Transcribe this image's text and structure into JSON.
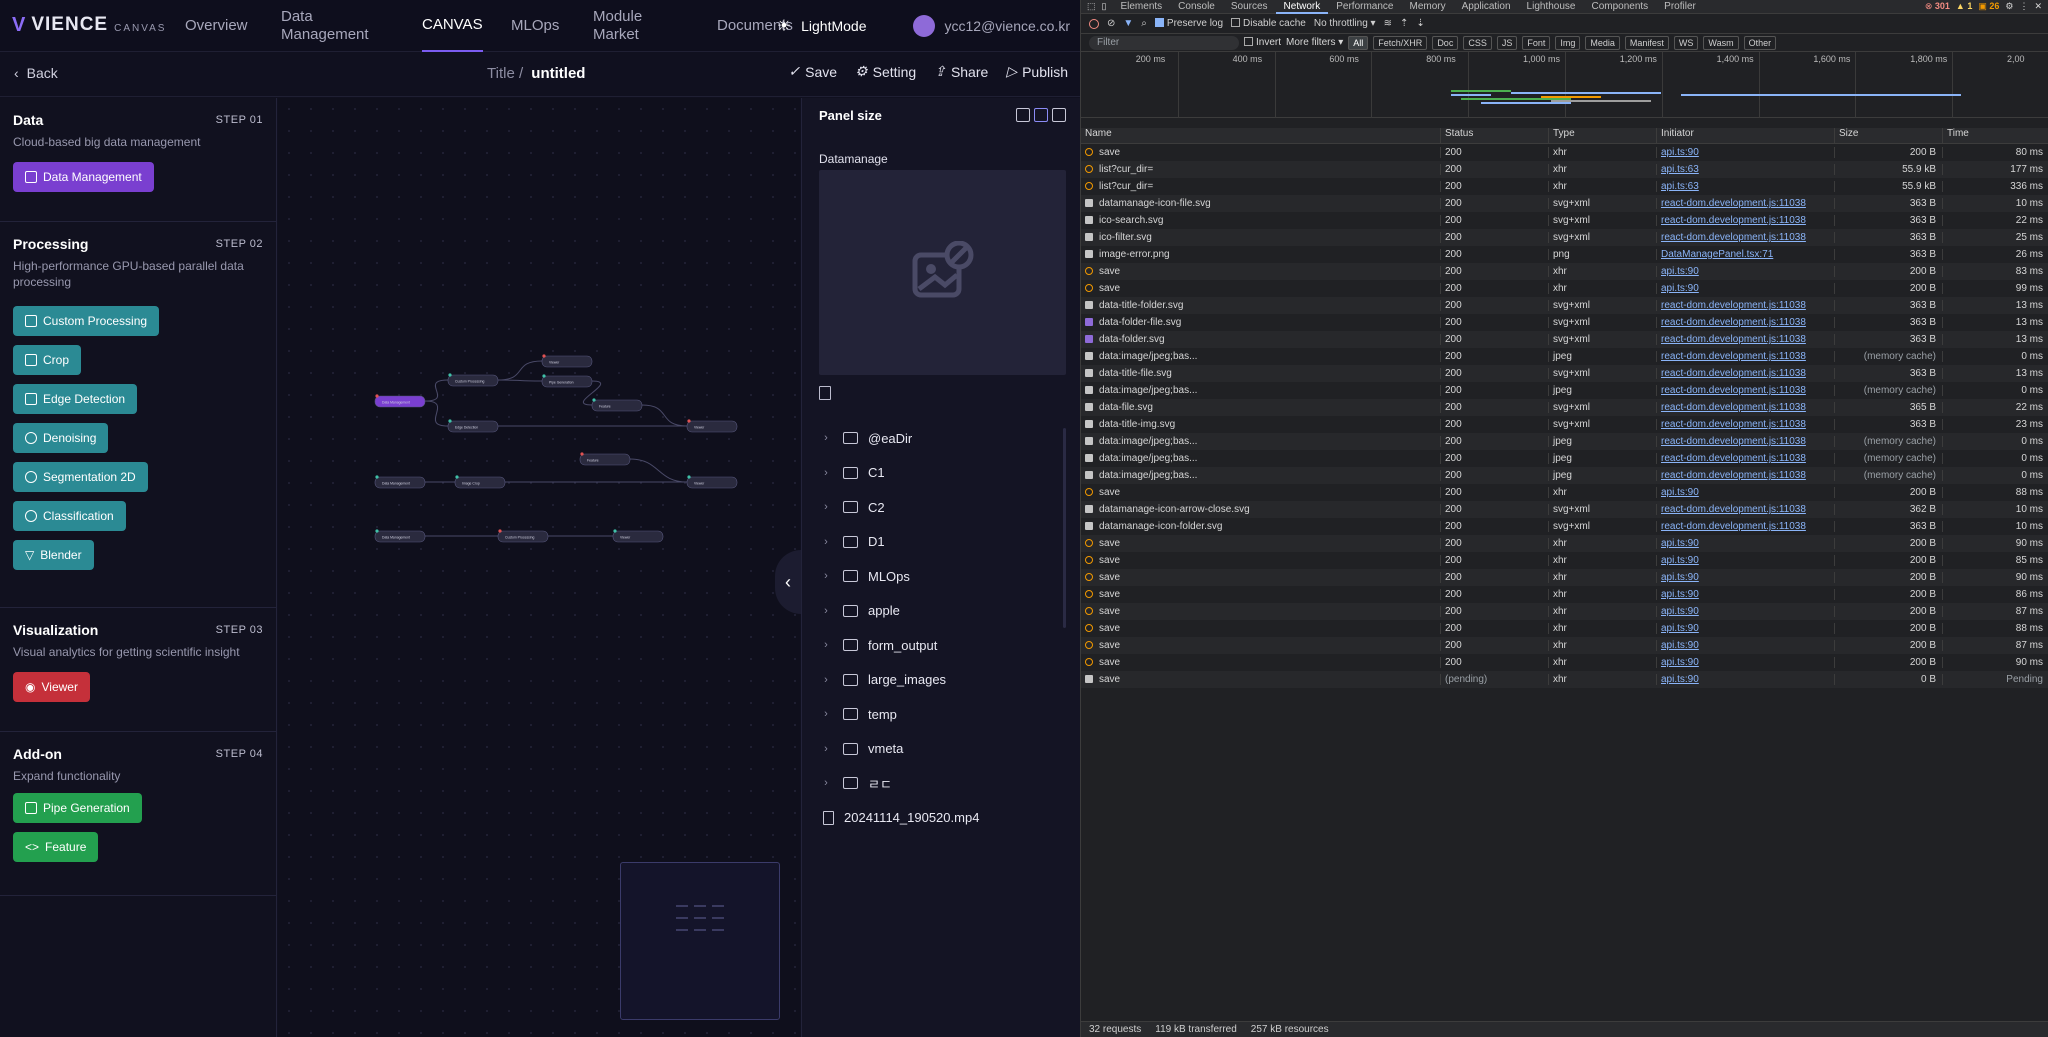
{
  "nav": {
    "logo_mark": "V",
    "logo_word": "VIENCE",
    "logo_sub": "CANVAS",
    "items": [
      "Overview",
      "Data Management",
      "CANVAS",
      "MLOps",
      "Module Market",
      "Documents"
    ],
    "active": "CANVAS",
    "theme_label": "LightMode",
    "user_email": "ycc12@vience.co.kr"
  },
  "toolbar": {
    "back_label": "Back",
    "title_prefix": "Title /",
    "title": "untitled",
    "save": "Save",
    "setting": "Setting",
    "share": "Share",
    "publish": "Publish"
  },
  "sidebar": {
    "sections": [
      {
        "title": "Data",
        "step": "STEP 01",
        "desc": "Cloud-based big data management",
        "buttons": [
          "Data Management"
        ]
      },
      {
        "title": "Processing",
        "step": "STEP 02",
        "desc": "High-performance GPU-based parallel data processing",
        "buttons": [
          "Custom Processing",
          "Crop",
          "Edge Detection",
          "Denoising",
          "Segmentation 2D",
          "Classification",
          "Blender"
        ]
      },
      {
        "title": "Visualization",
        "step": "STEP 03",
        "desc": "Visual analytics for getting scientific insight",
        "buttons": [
          "Viewer"
        ]
      },
      {
        "title": "Add-on",
        "step": "STEP 04",
        "desc": "Expand functionality",
        "buttons": [
          "Pipe Generation",
          "Feature"
        ]
      }
    ]
  },
  "canvas": {
    "nodes": [
      {
        "label": "Data Management",
        "color": "#7a3fd0"
      },
      {
        "label": "Custom Processing",
        "color": "#2a2a3e"
      },
      {
        "label": "Edge Detection",
        "color": "#2a2a3e"
      },
      {
        "label": "Viewer",
        "color": "#2a2a3e"
      },
      {
        "label": "Pipe Generation",
        "color": "#2a2a3e"
      },
      {
        "label": "Feature",
        "color": "#2a2a3e"
      },
      {
        "label": "Viewer",
        "color": "#2a2a3e"
      },
      {
        "label": "Data Management",
        "color": "#2a2a3e"
      },
      {
        "label": "Image Crop",
        "color": "#2a2a3e"
      },
      {
        "label": "Feature",
        "color": "#2a2a3e"
      },
      {
        "label": "Viewer",
        "color": "#2a2a3e"
      },
      {
        "label": "Data Management",
        "color": "#2a2a3e"
      },
      {
        "label": "Custom Processing",
        "color": "#2a2a3e"
      },
      {
        "label": "Viewer",
        "color": "#2a2a3e"
      }
    ]
  },
  "panel": {
    "title": "Panel size",
    "section_label": "Datamanage",
    "folders": [
      "@eaDir",
      "C1",
      "C2",
      "D1",
      "MLOps",
      "apple",
      "form_output",
      "large_images",
      "temp",
      "vmeta",
      "ㄹㄷ"
    ],
    "file": "20241114_190520.mp4"
  },
  "devtools": {
    "tabs": [
      "Elements",
      "Console",
      "Sources",
      "Network",
      "Performance",
      "Memory",
      "Application",
      "Lighthouse",
      "Components",
      "Profiler"
    ],
    "active_tab": "Network",
    "status": {
      "errors": "301",
      "warnings": "1",
      "info": "26"
    },
    "bar1": {
      "preserve_log": "Preserve log",
      "disable_cache": "Disable cache",
      "throttle": "No throttling"
    },
    "bar2": {
      "filter_placeholder": "Filter",
      "invert": "Invert",
      "more_filters": "More filters",
      "chips": [
        "All",
        "Fetch/XHR",
        "Doc",
        "CSS",
        "JS",
        "Font",
        "Img",
        "Media",
        "Manifest",
        "WS",
        "Wasm",
        "Other"
      ]
    },
    "timeline_ticks": [
      "200 ms",
      "400 ms",
      "600 ms",
      "800 ms",
      "1,000 ms",
      "1,200 ms",
      "1,400 ms",
      "1,600 ms",
      "1,800 ms",
      "2,00"
    ],
    "columns": [
      "Name",
      "Status",
      "Type",
      "Initiator",
      "Size",
      "Time"
    ],
    "rows": [
      [
        "save",
        "200",
        "xhr",
        "api.ts:90",
        "200 B",
        "80 ms",
        "xhr"
      ],
      [
        "list?cur_dir=",
        "200",
        "xhr",
        "api.ts:63",
        "55.9 kB",
        "177 ms",
        "xhr"
      ],
      [
        "list?cur_dir=",
        "200",
        "xhr",
        "api.ts:63",
        "55.9 kB",
        "336 ms",
        "xhr"
      ],
      [
        "datamanage-icon-file.svg",
        "200",
        "svg+xml",
        "react-dom.development.js:11038",
        "363 B",
        "10 ms",
        "svg"
      ],
      [
        "ico-search.svg",
        "200",
        "svg+xml",
        "react-dom.development.js:11038",
        "363 B",
        "22 ms",
        "svg"
      ],
      [
        "ico-filter.svg",
        "200",
        "svg+xml",
        "react-dom.development.js:11038",
        "363 B",
        "25 ms",
        "svg"
      ],
      [
        "image-error.png",
        "200",
        "png",
        "DataManagePanel.tsx:71",
        "363 B",
        "26 ms",
        "svg"
      ],
      [
        "save",
        "200",
        "xhr",
        "api.ts:90",
        "200 B",
        "83 ms",
        "xhr"
      ],
      [
        "save",
        "200",
        "xhr",
        "api.ts:90",
        "200 B",
        "99 ms",
        "xhr"
      ],
      [
        "data-title-folder.svg",
        "200",
        "svg+xml",
        "react-dom.development.js:11038",
        "363 B",
        "13 ms",
        "svg"
      ],
      [
        "data-folder-file.svg",
        "200",
        "svg+xml",
        "react-dom.development.js:11038",
        "363 B",
        "13 ms",
        "img"
      ],
      [
        "data-folder.svg",
        "200",
        "svg+xml",
        "react-dom.development.js:11038",
        "363 B",
        "13 ms",
        "img"
      ],
      [
        "data:image/jpeg;bas...",
        "200",
        "jpeg",
        "react-dom.development.js:11038",
        "(memory cache)",
        "0 ms",
        "svg"
      ],
      [
        "data-title-file.svg",
        "200",
        "svg+xml",
        "react-dom.development.js:11038",
        "363 B",
        "13 ms",
        "svg"
      ],
      [
        "data:image/jpeg;bas...",
        "200",
        "jpeg",
        "react-dom.development.js:11038",
        "(memory cache)",
        "0 ms",
        "svg"
      ],
      [
        "data-file.svg",
        "200",
        "svg+xml",
        "react-dom.development.js:11038",
        "365 B",
        "22 ms",
        "svg"
      ],
      [
        "data-title-img.svg",
        "200",
        "svg+xml",
        "react-dom.development.js:11038",
        "363 B",
        "23 ms",
        "svg"
      ],
      [
        "data:image/jpeg;bas...",
        "200",
        "jpeg",
        "react-dom.development.js:11038",
        "(memory cache)",
        "0 ms",
        "svg"
      ],
      [
        "data:image/jpeg;bas...",
        "200",
        "jpeg",
        "react-dom.development.js:11038",
        "(memory cache)",
        "0 ms",
        "svg"
      ],
      [
        "data:image/jpeg;bas...",
        "200",
        "jpeg",
        "react-dom.development.js:11038",
        "(memory cache)",
        "0 ms",
        "svg"
      ],
      [
        "save",
        "200",
        "xhr",
        "api.ts:90",
        "200 B",
        "88 ms",
        "xhr"
      ],
      [
        "datamanage-icon-arrow-close.svg",
        "200",
        "svg+xml",
        "react-dom.development.js:11038",
        "362 B",
        "10 ms",
        "svg"
      ],
      [
        "datamanage-icon-folder.svg",
        "200",
        "svg+xml",
        "react-dom.development.js:11038",
        "363 B",
        "10 ms",
        "svg"
      ],
      [
        "save",
        "200",
        "xhr",
        "api.ts:90",
        "200 B",
        "90 ms",
        "xhr"
      ],
      [
        "save",
        "200",
        "xhr",
        "api.ts:90",
        "200 B",
        "85 ms",
        "xhr"
      ],
      [
        "save",
        "200",
        "xhr",
        "api.ts:90",
        "200 B",
        "90 ms",
        "xhr"
      ],
      [
        "save",
        "200",
        "xhr",
        "api.ts:90",
        "200 B",
        "86 ms",
        "xhr"
      ],
      [
        "save",
        "200",
        "xhr",
        "api.ts:90",
        "200 B",
        "87 ms",
        "xhr"
      ],
      [
        "save",
        "200",
        "xhr",
        "api.ts:90",
        "200 B",
        "88 ms",
        "xhr"
      ],
      [
        "save",
        "200",
        "xhr",
        "api.ts:90",
        "200 B",
        "87 ms",
        "xhr"
      ],
      [
        "save",
        "200",
        "xhr",
        "api.ts:90",
        "200 B",
        "90 ms",
        "xhr"
      ],
      [
        "save",
        "(pending)",
        "xhr",
        "api.ts:90",
        "0 B",
        "Pending",
        "svg"
      ]
    ],
    "footer": [
      "32 requests",
      "119 kB transferred",
      "257 kB resources"
    ]
  }
}
